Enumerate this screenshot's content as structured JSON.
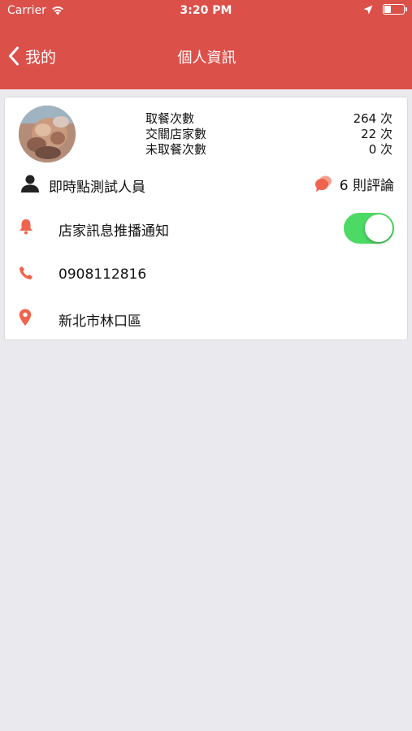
{
  "status_bar": {
    "carrier": "Carrier",
    "time": "3:20 PM"
  },
  "nav": {
    "back_label": "我的",
    "title": "個人資訊"
  },
  "profile": {
    "stats": [
      {
        "label": "取餐次數",
        "value": "264 次"
      },
      {
        "label": "交關店家數",
        "value": "22 次"
      },
      {
        "label": "未取餐次數",
        "value": "0 次"
      }
    ],
    "name": "即時點測試人員",
    "reviews": "6 則評論"
  },
  "settings": {
    "push_label": "店家訊息推播通知",
    "push_enabled": true
  },
  "contact": {
    "phone": "0908112816",
    "location": "新北市林口區"
  },
  "colors": {
    "brand": "#dc504a",
    "accent_icon": "#f0634c",
    "toggle_on": "#4cd964",
    "background": "#e9e9ee"
  },
  "icons": {
    "wifi": "wifi-icon",
    "location_arrow": "location-arrow-icon",
    "battery": "battery-icon",
    "back": "chevron-left-icon",
    "person": "person-icon",
    "chat": "chat-bubbles-icon",
    "bell": "bell-icon",
    "phone": "phone-icon",
    "map_pin": "map-pin-icon"
  }
}
